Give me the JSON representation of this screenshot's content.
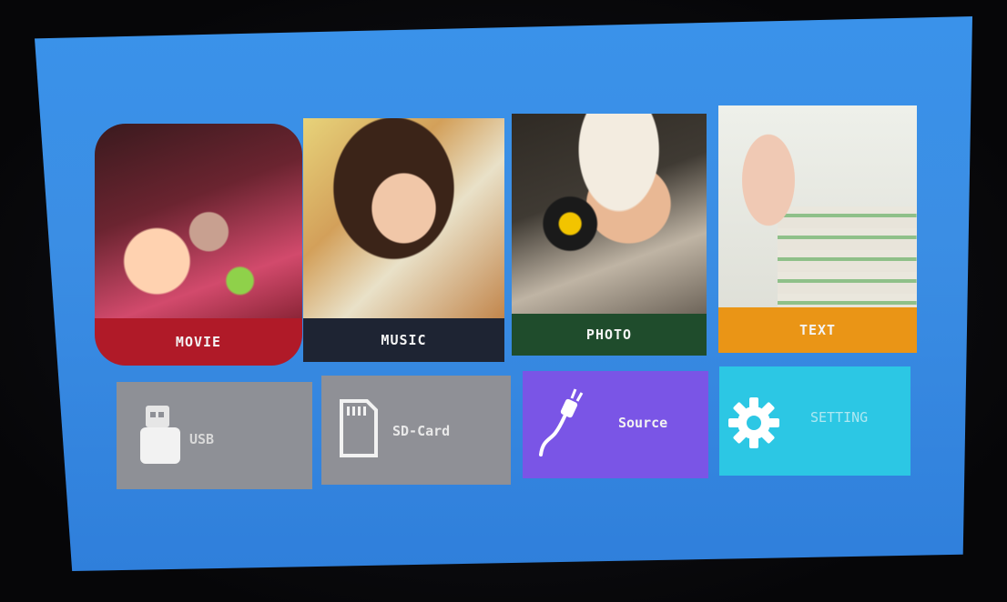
{
  "menu": {
    "tiles": [
      {
        "label": "MOVIE",
        "icon": "movie-photo",
        "bar_color": "#b01a28"
      },
      {
        "label": "MUSIC",
        "icon": "music-photo",
        "bar_color": "#1e2433"
      },
      {
        "label": "PHOTO",
        "icon": "photo-photo",
        "bar_color": "#1f4c2c"
      },
      {
        "label": "TEXT",
        "icon": "text-photo",
        "bar_color": "#ea9516"
      }
    ],
    "sources": [
      {
        "label": "USB",
        "icon": "usb-drive-icon",
        "color": "#8e9096"
      },
      {
        "label": "SD-Card",
        "icon": "sd-card-icon",
        "color": "#8f9096"
      },
      {
        "label": "Source",
        "icon": "cable-plug-icon",
        "color": "#7a55e6"
      },
      {
        "label": "SETTING",
        "icon": "gear-icon",
        "color": "#2cc7e4"
      }
    ]
  },
  "theme": {
    "background": "#3a8fe6"
  }
}
